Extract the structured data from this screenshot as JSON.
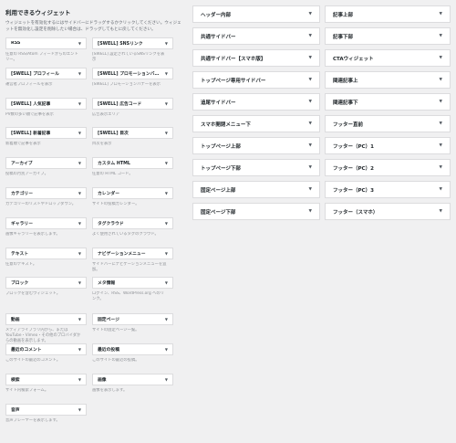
{
  "panel": {
    "title": "利用できるウィジェット",
    "description": "ウィジェットを有効化するにはサイドバーにドラッグするかクリックしてください。ウィジェットを無効化し設定を削除したい場合は、ドラッグしてもとに戻してください。"
  },
  "widgets": [
    {
      "name": "RSS",
      "desc": "任意の RSS/Atom フィードからのエントリー。"
    },
    {
      "name": "[SWELL] SNSリンク",
      "desc": "[SWELL] 設定されているSNSリンクを表示"
    },
    {
      "name": "[SWELL] プロフィール",
      "desc": "運営者プロフィールを表示"
    },
    {
      "name": "[SWELL] プロモーションバナー",
      "desc": "[SWELL] プロモーションバナーを表示"
    },
    {
      "name": "[SWELL] 人気記事",
      "desc": "PV数の多い順で記事を表示"
    },
    {
      "name": "[SWELL] 広告コード",
      "desc": "広告表示エリア"
    },
    {
      "name": "[SWELL] 新着記事",
      "desc": "新着順で記事を表示"
    },
    {
      "name": "[SWELL] 目次",
      "desc": "目次を表示"
    },
    {
      "name": "アーカイブ",
      "desc": "投稿の月別アーカイブ。"
    },
    {
      "name": "カスタム HTML",
      "desc": "任意の HTML コード。"
    },
    {
      "name": "カテゴリー",
      "desc": "カテゴリーのリストやドロップダウン。"
    },
    {
      "name": "カレンダー",
      "desc": "サイトの投稿カレンダー。"
    },
    {
      "name": "ギャラリー",
      "desc": "画像ギャラリーを表示します。"
    },
    {
      "name": "タグクラウド",
      "desc": "よく使用されているタグのクラウド。"
    },
    {
      "name": "テキスト",
      "desc": "任意のテキスト。"
    },
    {
      "name": "ナビゲーションメニュー",
      "desc": "サイドバーにナビゲーションメニューを追加。"
    },
    {
      "name": "ブロック",
      "desc": "ブロックを含むウィジェット。"
    },
    {
      "name": "メタ情報",
      "desc": "ログイン、RSS、WordPress.org へのリンク。"
    },
    {
      "name": "動画",
      "desc": "メディアライブラリ内から、または YouTube・Vimeo・その他のプロバイダからの動画を表示します。"
    },
    {
      "name": "固定ページ",
      "desc": "サイトの固定ページ一覧。"
    },
    {
      "name": "最近のコメント",
      "desc": "このサイトの最近のコメント。"
    },
    {
      "name": "最近の投稿",
      "desc": "このサイトの最近の投稿。"
    },
    {
      "name": "検索",
      "desc": "サイト内検索フォーム。"
    },
    {
      "name": "画像",
      "desc": "画像を表示します。"
    },
    {
      "name": "音声",
      "desc": "音声プレーヤーを表示します。"
    }
  ],
  "areas_col1": [
    "ヘッダー内部",
    "共通サイドバー",
    "共通サイドバー【スマホ版】",
    "トップページ専用サイドバー",
    "追尾サイドバー",
    "スマホ開閉メニュー下",
    "トップページ上部",
    "トップページ下部",
    "固定ページ上部",
    "固定ページ下部"
  ],
  "areas_col2": [
    "記事上部",
    "記事下部",
    "CTAウィジェット",
    "関連記事上",
    "関連記事下",
    "フッター直前",
    "フッター（PC）1",
    "フッター（PC）2",
    "フッター（PC）3",
    "フッター（スマホ）"
  ],
  "icons": {
    "expand_arrow": "▼"
  }
}
